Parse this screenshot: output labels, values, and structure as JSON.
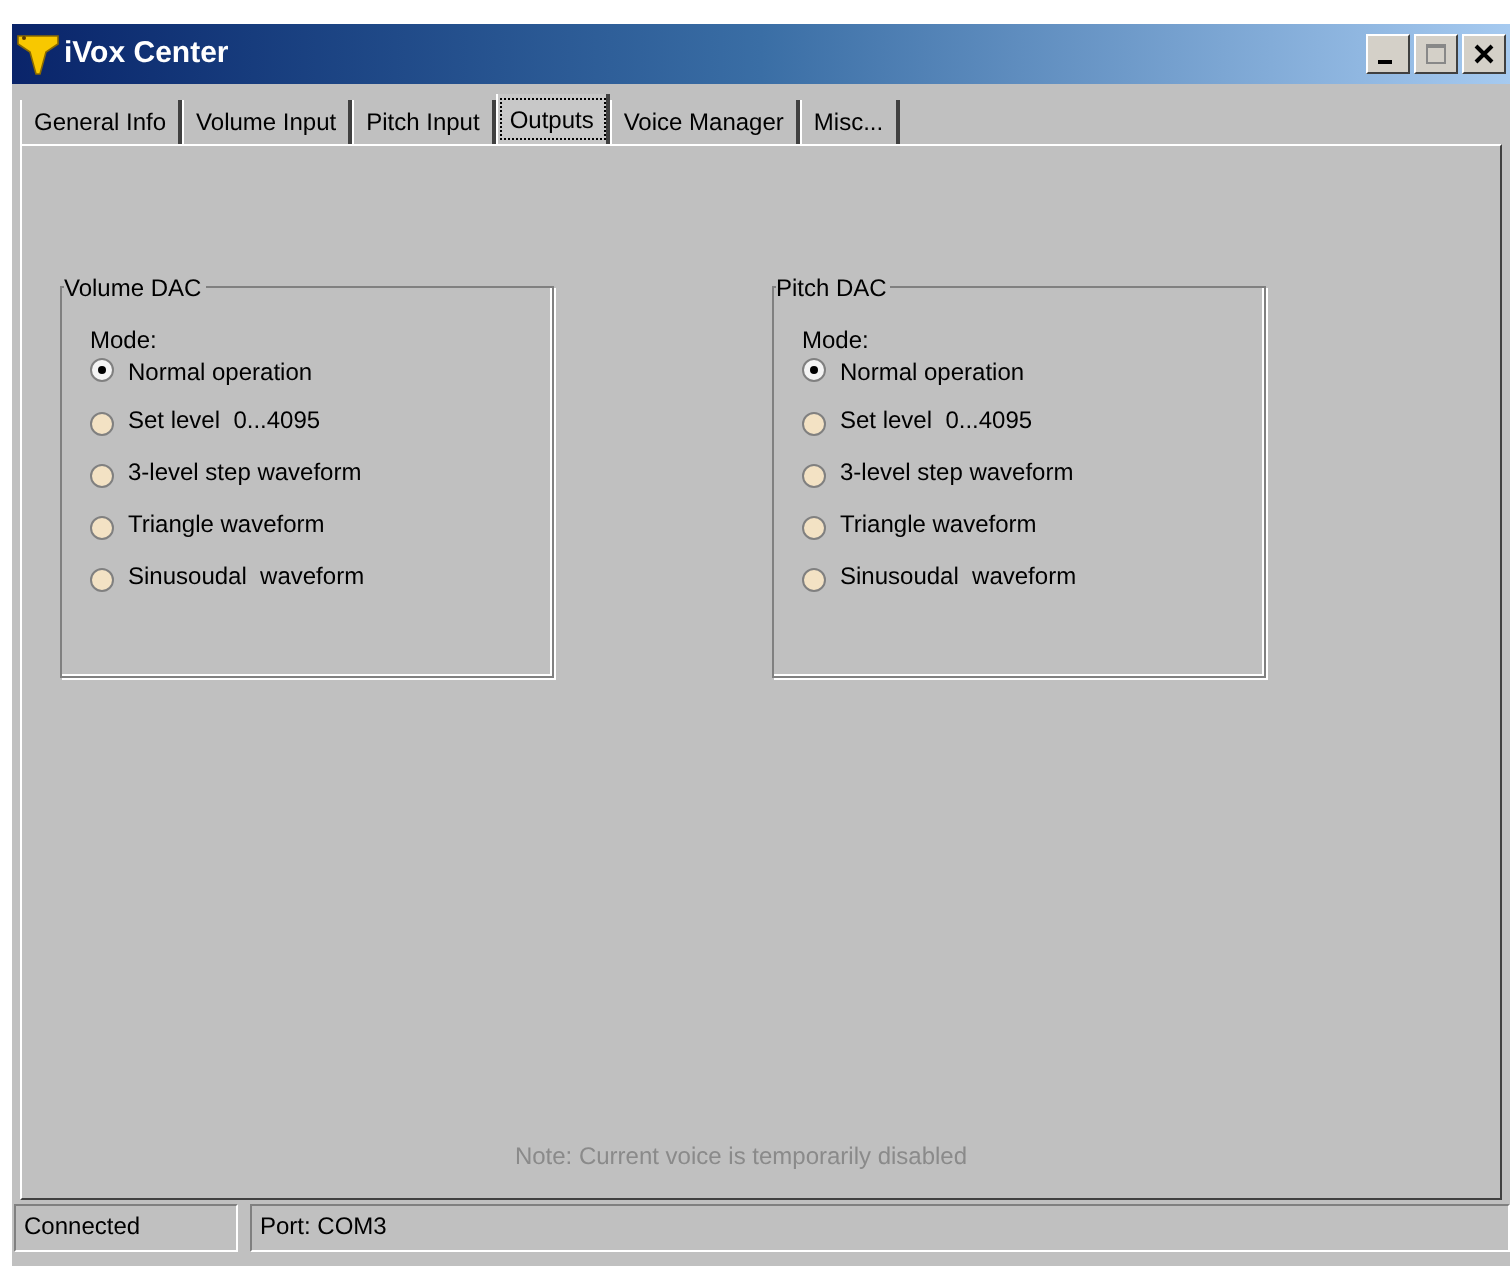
{
  "window": {
    "title": "iVox Center"
  },
  "tabs": [
    {
      "label": "General Info",
      "selected": false
    },
    {
      "label": "Volume Input",
      "selected": false
    },
    {
      "label": "Pitch Input",
      "selected": false
    },
    {
      "label": "Outputs",
      "selected": true
    },
    {
      "label": "Voice Manager",
      "selected": false
    },
    {
      "label": "Misc...",
      "selected": false
    }
  ],
  "groups": [
    {
      "title": "Volume DAC",
      "mode_label": "Mode:",
      "options": [
        {
          "label": "Normal operation",
          "selected": true
        },
        {
          "label": "Set level  0...4095",
          "selected": false
        },
        {
          "label": "3-level step waveform",
          "selected": false
        },
        {
          "label": "Triangle waveform",
          "selected": false
        },
        {
          "label": "Sinusoudal  waveform",
          "selected": false
        }
      ]
    },
    {
      "title": "Pitch DAC",
      "mode_label": "Mode:",
      "options": [
        {
          "label": "Normal operation",
          "selected": true
        },
        {
          "label": "Set level  0...4095",
          "selected": false
        },
        {
          "label": "3-level step waveform",
          "selected": false
        },
        {
          "label": "Triangle waveform",
          "selected": false
        },
        {
          "label": "Sinusoudal  waveform",
          "selected": false
        }
      ]
    }
  ],
  "note": "Note: Current voice is temporarily disabled",
  "status_bar": [
    "Connected",
    "Port: COM3"
  ]
}
